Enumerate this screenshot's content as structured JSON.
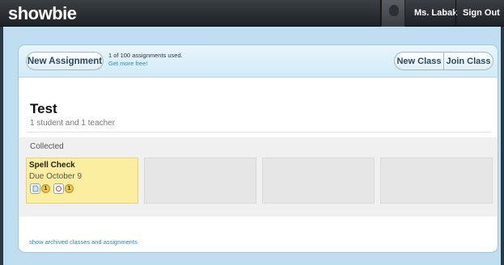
{
  "header": {
    "logo": "showbie",
    "user_name": "Ms. Labak",
    "sign_out": "Sign Out"
  },
  "toolbar": {
    "new_assignment": "New Assignment",
    "usage_text": "1 of 100 assignments used.",
    "usage_link": "Get more free!",
    "new_class": "New Class",
    "join_class": "Join Class"
  },
  "class": {
    "title": "Test",
    "subtitle": "1 student and 1 teacher",
    "section_label": "Collected"
  },
  "assignments": [
    {
      "title": "Spell Check",
      "due": "Due October 9",
      "stats": [
        {
          "icon": "file-icon",
          "count": "1"
        },
        {
          "icon": "comment-icon",
          "count": "1"
        }
      ]
    }
  ],
  "footer": {
    "archived_link": "show archived classes and assignments"
  }
}
